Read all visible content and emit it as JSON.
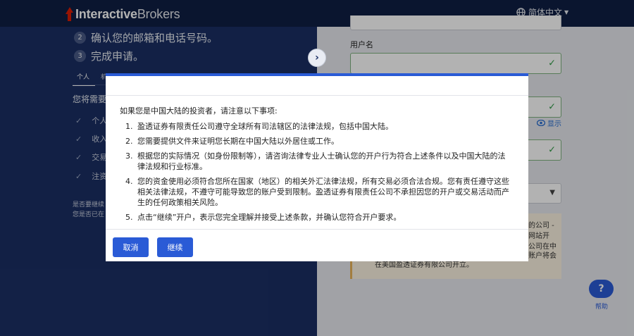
{
  "header": {
    "brand_bold": "Interactive",
    "brand_light": "Brokers",
    "language": "简体中文"
  },
  "left": {
    "steps": [
      {
        "num": "2",
        "text": "确认您的邮箱和电话号码。"
      },
      {
        "num": "3",
        "text": "完成申请。"
      }
    ],
    "tabs": [
      "个人",
      "机构"
    ],
    "need_title": "您将需要",
    "checklist": [
      "个人",
      "收入",
      "交易",
      "注资"
    ],
    "notes": [
      "是否要继续",
      "您是否已在"
    ]
  },
  "right": {
    "username_label": "用户名",
    "show_password": "显示",
    "warning_lines": [
      "的公司 -",
      "网站开",
      "公司在中",
      "账户将会",
      "在美国盈透证券有限公司开立。"
    ]
  },
  "help": {
    "icon": "?",
    "label": "帮助"
  },
  "modal": {
    "intro": "如果您是中国大陆的投资者，请注意以下事项:",
    "items": [
      {
        "idx": "1.",
        "text": "盈透证券有限责任公司遵守全球所有司法辖区的法律法规，包括中国大陆。"
      },
      {
        "idx": "2.",
        "text": "您需要提供文件来证明您长期在中国大陆以外居住或工作。"
      },
      {
        "idx": "3.",
        "text": "根据您的实际情况（如身份限制等），请咨询法律专业人士确认您的开户行为符合上述条件以及中国大陆的法律法规和行业标准。"
      },
      {
        "idx": "4.",
        "text": "您的资金使用必须符合您所在国家（地区）的相关外汇法律法规，所有交易必须合法合规。您有责任遵守这些相关法律法规，不遵守可能导致您的账户受到限制。盈透证券有限责任公司不承担因您的开户或交易活动而产生的任何政策相关风险。"
      },
      {
        "idx": "5.",
        "text": "点击“继续”开户，表示您完全理解并接受上述条款，并确认您符合开户要求。"
      }
    ],
    "cancel_label": "取消",
    "continue_label": "继续"
  },
  "colors": {
    "accent": "#2a5bd6",
    "header_bg": "#0f1f44",
    "left_panel_bg": "#1b2f64",
    "success": "#2e9a44",
    "logo_red": "#d81e05"
  }
}
